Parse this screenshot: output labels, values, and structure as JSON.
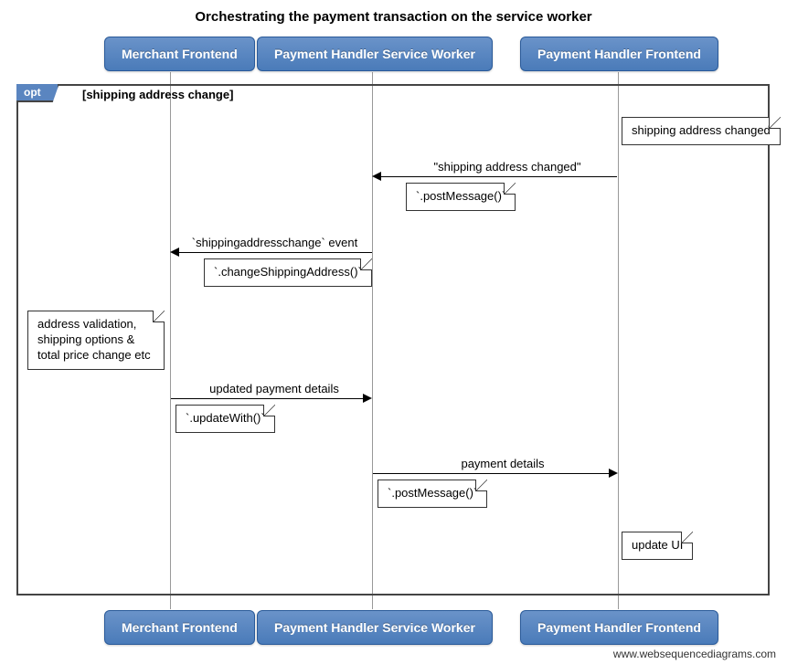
{
  "title": "Orchestrating the payment transaction on the service worker",
  "participants": {
    "merchant": "Merchant Frontend",
    "sw": "Payment Handler Service Worker",
    "frontend": "Payment Handler Frontend"
  },
  "fragment": {
    "type": "opt",
    "condition": "[shipping address change]"
  },
  "notes": {
    "n1": "shipping address changed",
    "n2": "address validation,\nshipping options &\ntotal price change etc",
    "n3": "update UI"
  },
  "messages": {
    "m1": {
      "label": "\"shipping address changed\"",
      "method": "`.postMessage()`"
    },
    "m2": {
      "label": "`shippingaddresschange` event",
      "method": "`.changeShippingAddress()`"
    },
    "m3": {
      "label": "updated payment details",
      "method": "`.updateWith()`"
    },
    "m4": {
      "label": "payment details",
      "method": "`.postMessage()`"
    }
  },
  "watermark": "www.websequencediagrams.com",
  "chart_data": {
    "type": "sequence-diagram",
    "title": "Orchestrating the payment transaction on the service worker",
    "participants": [
      "Merchant Frontend",
      "Payment Handler Service Worker",
      "Payment Handler Frontend"
    ],
    "fragments": [
      {
        "type": "opt",
        "condition": "shipping address change",
        "steps": [
          {
            "kind": "note",
            "over": "Payment Handler Frontend",
            "text": "shipping address changed"
          },
          {
            "kind": "message",
            "from": "Payment Handler Frontend",
            "to": "Payment Handler Service Worker",
            "label": "\"shipping address changed\"",
            "method": ".postMessage()"
          },
          {
            "kind": "message",
            "from": "Payment Handler Service Worker",
            "to": "Merchant Frontend",
            "label": "`shippingaddresschange` event",
            "method": ".changeShippingAddress()"
          },
          {
            "kind": "note",
            "over": "Merchant Frontend",
            "text": "address validation, shipping options & total price change etc"
          },
          {
            "kind": "message",
            "from": "Merchant Frontend",
            "to": "Payment Handler Service Worker",
            "label": "updated payment details",
            "method": ".updateWith()"
          },
          {
            "kind": "message",
            "from": "Payment Handler Service Worker",
            "to": "Payment Handler Frontend",
            "label": "payment details",
            "method": ".postMessage()"
          },
          {
            "kind": "note",
            "over": "Payment Handler Frontend",
            "text": "update UI"
          }
        ]
      }
    ]
  }
}
